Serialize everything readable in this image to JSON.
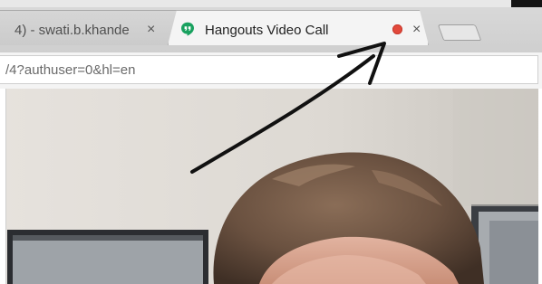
{
  "browser": {
    "tabs": [
      {
        "label": "4) - swati.b.khande",
        "close_glyph": "×",
        "active": false
      },
      {
        "label": "Hangouts Video Call",
        "close_glyph": "×",
        "active": true,
        "icon": "hangouts-icon",
        "recording_indicator_color": "#e2493b"
      }
    ],
    "new_tab_icon": "new-tab-icon",
    "address_bar": {
      "value": "/4?authuser=0&hl=en"
    }
  },
  "video_call": {
    "content": "webcam-video-feed"
  },
  "annotation": {
    "type": "arrow",
    "color": "#111111",
    "points_to": "record-indicator"
  },
  "colors": {
    "hangouts_green": "#19a15f",
    "record_red": "#e2493b",
    "wall": "#dedbd7",
    "hair": "#6e5644",
    "skin": "#d8a38c"
  }
}
